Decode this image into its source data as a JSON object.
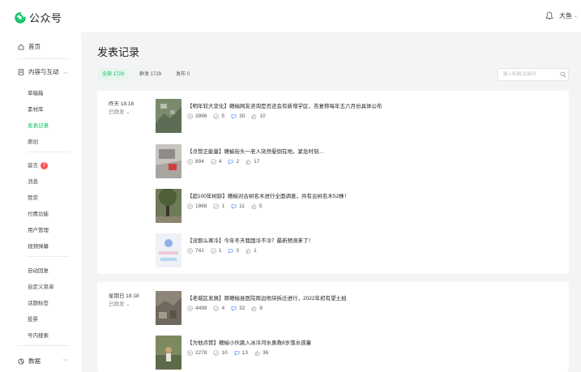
{
  "brand": {
    "name": "公众号",
    "icon": "wechat-mp-logo-icon",
    "color": "#07c160"
  },
  "header": {
    "user_name": "大鱼",
    "bell_icon": "bell-icon",
    "user_chevron": "⌄"
  },
  "sidebar": {
    "home": "首页",
    "content_group": "内容与互动",
    "content_items": [
      "草稿箱",
      "素材库",
      "发表记录",
      "原创"
    ],
    "active_item": "发表记录",
    "manage_items": [
      "留言",
      "消息",
      "赞赏",
      "付费功能",
      "用户管理",
      "视频弹幕"
    ],
    "comment_badge": "2",
    "service_items": [
      "自动回复",
      "自定义菜单",
      "话题标签",
      "投票",
      "号内搜索"
    ],
    "data_group": "数据"
  },
  "main": {
    "title": "发表记录",
    "tabs": [
      {
        "label": "全部 1729",
        "active": true
      },
      {
        "label": "群发 1729",
        "active": false
      },
      {
        "label": "发布 0",
        "active": false
      }
    ],
    "search_placeholder": "输入标题/关键词"
  },
  "groups": [
    {
      "date": "昨天 18:18",
      "status": "已群发 ⌄",
      "articles": [
        {
          "title": "【明年较大变化】赣榆网友咨询是否还会有新增学区，答复称每年五六月份具体公布",
          "reads": "3996",
          "likes": "5",
          "comments": "30",
          "shares": "10"
        },
        {
          "title": "【点赞正能量】赣榆街头一老人突然晕倒在地，紧急时刻...",
          "reads": "894",
          "likes": "4",
          "comments": "2",
          "shares": "17"
        },
        {
          "title": "【超100年树龄】赣榆对古树名木进行全面调查，共有古树名木52株！",
          "reads": "1868",
          "likes": "1",
          "comments": "11",
          "shares": "5"
        },
        {
          "title": "【没那么寒冷】今年冬天我国冷不冷？最新预测来了！",
          "reads": "741",
          "likes": "1",
          "comments": "0",
          "shares": "1"
        }
      ]
    },
    {
      "date": "星期日 18:18",
      "status": "已群发 ⌄",
      "articles": [
        {
          "title": "【老城区发展】原赣榆县医院周边地块拆迁进行，2022年初有望土拍",
          "reads": "4499",
          "likes": "4",
          "comments": "32",
          "shares": "8"
        },
        {
          "title": "【为他点赞】赣榆小伙跳入冰冷河水勇救8岁落水孩童",
          "reads": "2278",
          "likes": "10",
          "comments": "13",
          "shares": "36"
        }
      ]
    }
  ]
}
